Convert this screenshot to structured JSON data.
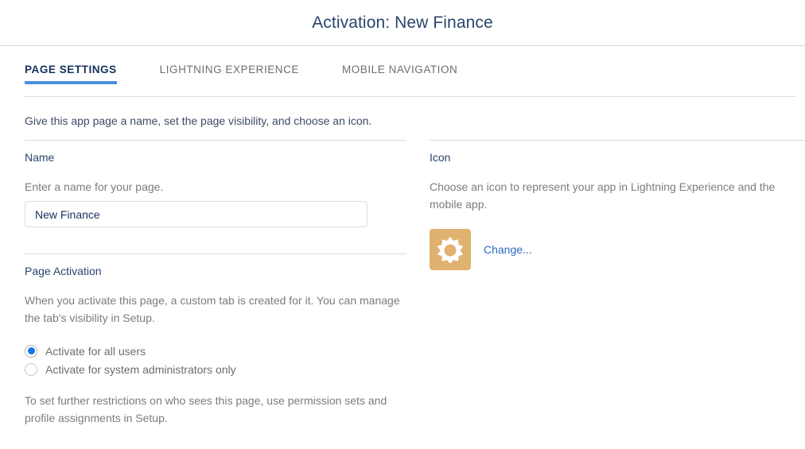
{
  "header": {
    "title": "Activation: New Finance"
  },
  "tabs": [
    {
      "label": "PAGE SETTINGS",
      "active": true
    },
    {
      "label": "LIGHTNING EXPERIENCE",
      "active": false
    },
    {
      "label": "MOBILE NAVIGATION",
      "active": false
    }
  ],
  "intro": "Give this app page a name, set the page visibility, and choose an icon.",
  "name_section": {
    "title": "Name",
    "helper": "Enter a name for your page.",
    "input_value": "New Finance",
    "input_placeholder": "Enter a name for your page."
  },
  "page_activation_section": {
    "title": "Page Activation",
    "helper": "When you activate this page, a custom tab is created for it. You can manage the tab's visibility in Setup.",
    "options": [
      {
        "label": "Activate for all users",
        "selected": true
      },
      {
        "label": "Activate for system administrators only",
        "selected": false
      }
    ],
    "footnote": "To set further restrictions on who sees this page, use permission sets and profile assignments in Setup."
  },
  "icon_section": {
    "title": "Icon",
    "helper": "Choose an icon to represent your app in Lightning Experience and the mobile app.",
    "icon_name": "sun-icon",
    "icon_background_color": "#E0B26F",
    "icon_glyph_color": "#FFFFFF",
    "change_label": "Change..."
  },
  "colors": {
    "title_text": "#28456B",
    "active_tab_text": "#16325C",
    "active_tab_underline": "#4A90E2",
    "inactive_tab_text": "#706E6B",
    "link": "#2B6CC4",
    "radio_selected": "#1A73E8",
    "divider": "#DDDBDA"
  }
}
